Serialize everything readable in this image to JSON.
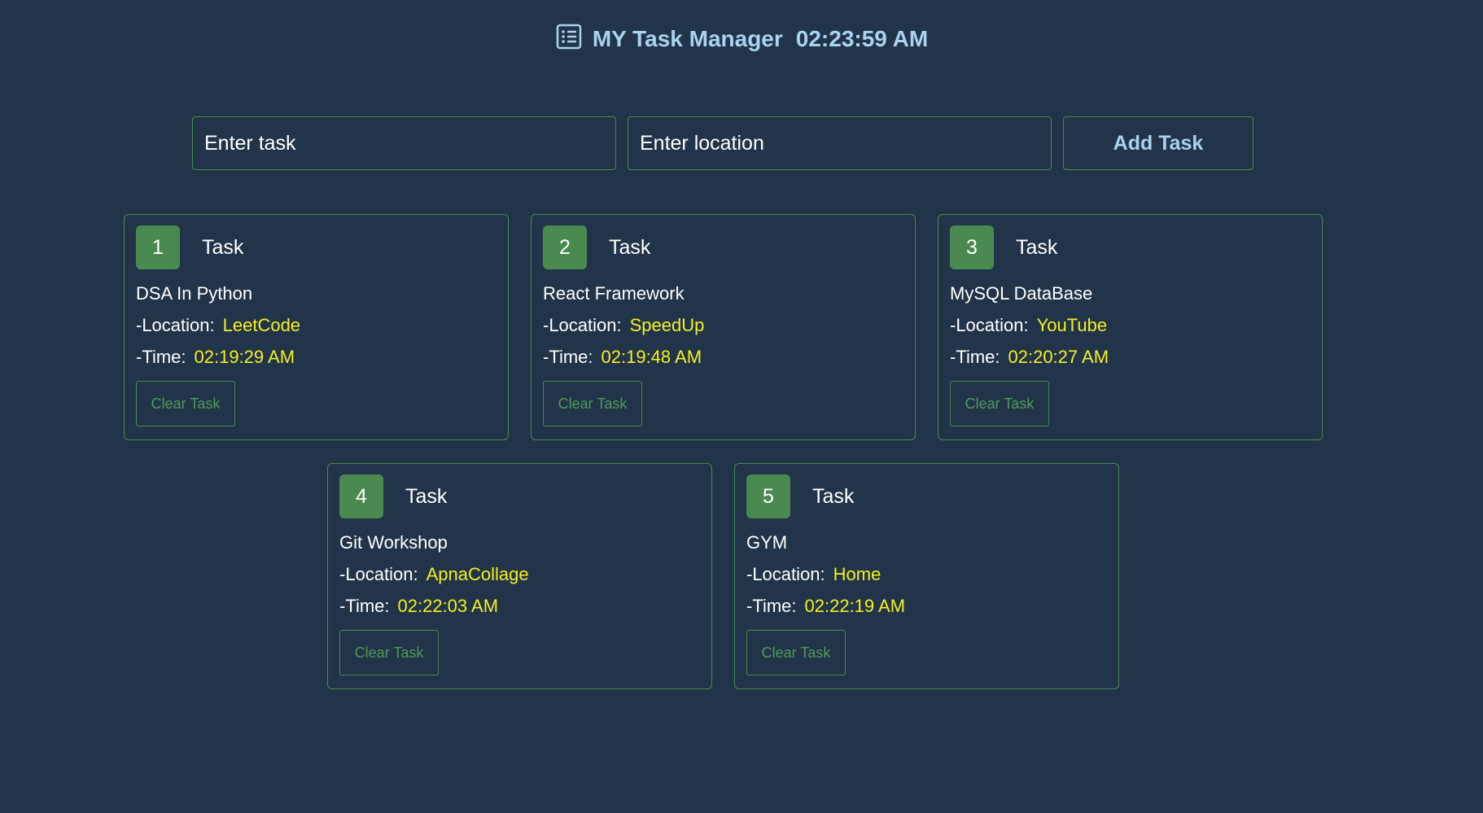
{
  "header": {
    "title": "MY Task Manager",
    "clock": "02:23:59 AM",
    "icon": "list-icon"
  },
  "form": {
    "task_placeholder": "Enter task",
    "location_placeholder": "Enter location",
    "add_label": "Add Task"
  },
  "colors": {
    "background": "#223449",
    "accent": "#4a8a50",
    "highlight": "#f5f01e",
    "title": "#a9d3ee"
  },
  "tasks": [
    {
      "number": "1",
      "label": "Task",
      "name": "DSA In Python",
      "location_label": "-Location:",
      "location": "LeetCode",
      "time_label": "-Time:",
      "time": "02:19:29 AM",
      "clear_label": "Clear Task"
    },
    {
      "number": "2",
      "label": "Task",
      "name": "React Framework",
      "location_label": "-Location:",
      "location": "SpeedUp",
      "time_label": "-Time:",
      "time": "02:19:48 AM",
      "clear_label": "Clear Task"
    },
    {
      "number": "3",
      "label": "Task",
      "name": "MySQL DataBase",
      "location_label": "-Location:",
      "location": "YouTube",
      "time_label": "-Time:",
      "time": "02:20:27 AM",
      "clear_label": "Clear Task"
    },
    {
      "number": "4",
      "label": "Task",
      "name": "Git Workshop",
      "location_label": "-Location:",
      "location": "ApnaCollage",
      "time_label": "-Time:",
      "time": "02:22:03 AM",
      "clear_label": "Clear Task"
    },
    {
      "number": "5",
      "label": "Task",
      "name": "GYM",
      "location_label": "-Location:",
      "location": "Home",
      "time_label": "-Time:",
      "time": "02:22:19 AM",
      "clear_label": "Clear Task"
    }
  ]
}
